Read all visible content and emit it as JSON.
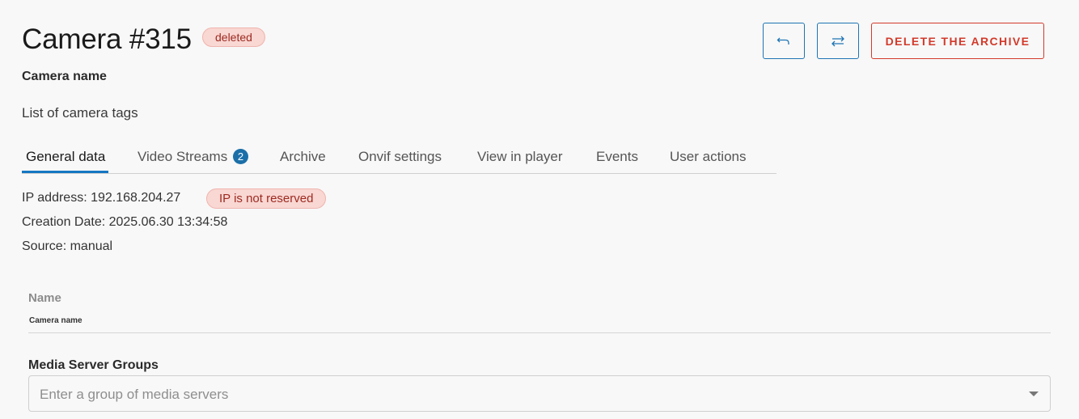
{
  "header": {
    "title": "Camera #315",
    "status_badge": "deleted",
    "camera_name": "Camera name",
    "tags_text": "List of camera tags"
  },
  "actions": {
    "undo_icon": "undo-arrow-icon",
    "swap_icon": "swap-arrows-icon",
    "delete_label": "DELETE THE ARCHIVE"
  },
  "tabs": [
    {
      "label": "General data",
      "active": true
    },
    {
      "label": "Video Streams",
      "count": "2"
    },
    {
      "label": "Archive"
    },
    {
      "label": "Onvif settings"
    },
    {
      "label": "View in player"
    },
    {
      "label": "Events"
    },
    {
      "label": "User actions"
    }
  ],
  "general": {
    "ip_label": "IP address: 192.168.204.27",
    "ip_badge": "IP is not reserved",
    "creation": "Creation Date: 2025.06.30 13:34:58",
    "source": "Source: manual"
  },
  "form": {
    "name_label": "Name",
    "name_value": "Camera name",
    "groups_label": "Media Server Groups",
    "groups_placeholder": "Enter a group of media servers"
  },
  "colors": {
    "accent_blue": "#1577c2",
    "danger_red": "#d23a2b",
    "badge_bg": "#f9d7d3"
  }
}
